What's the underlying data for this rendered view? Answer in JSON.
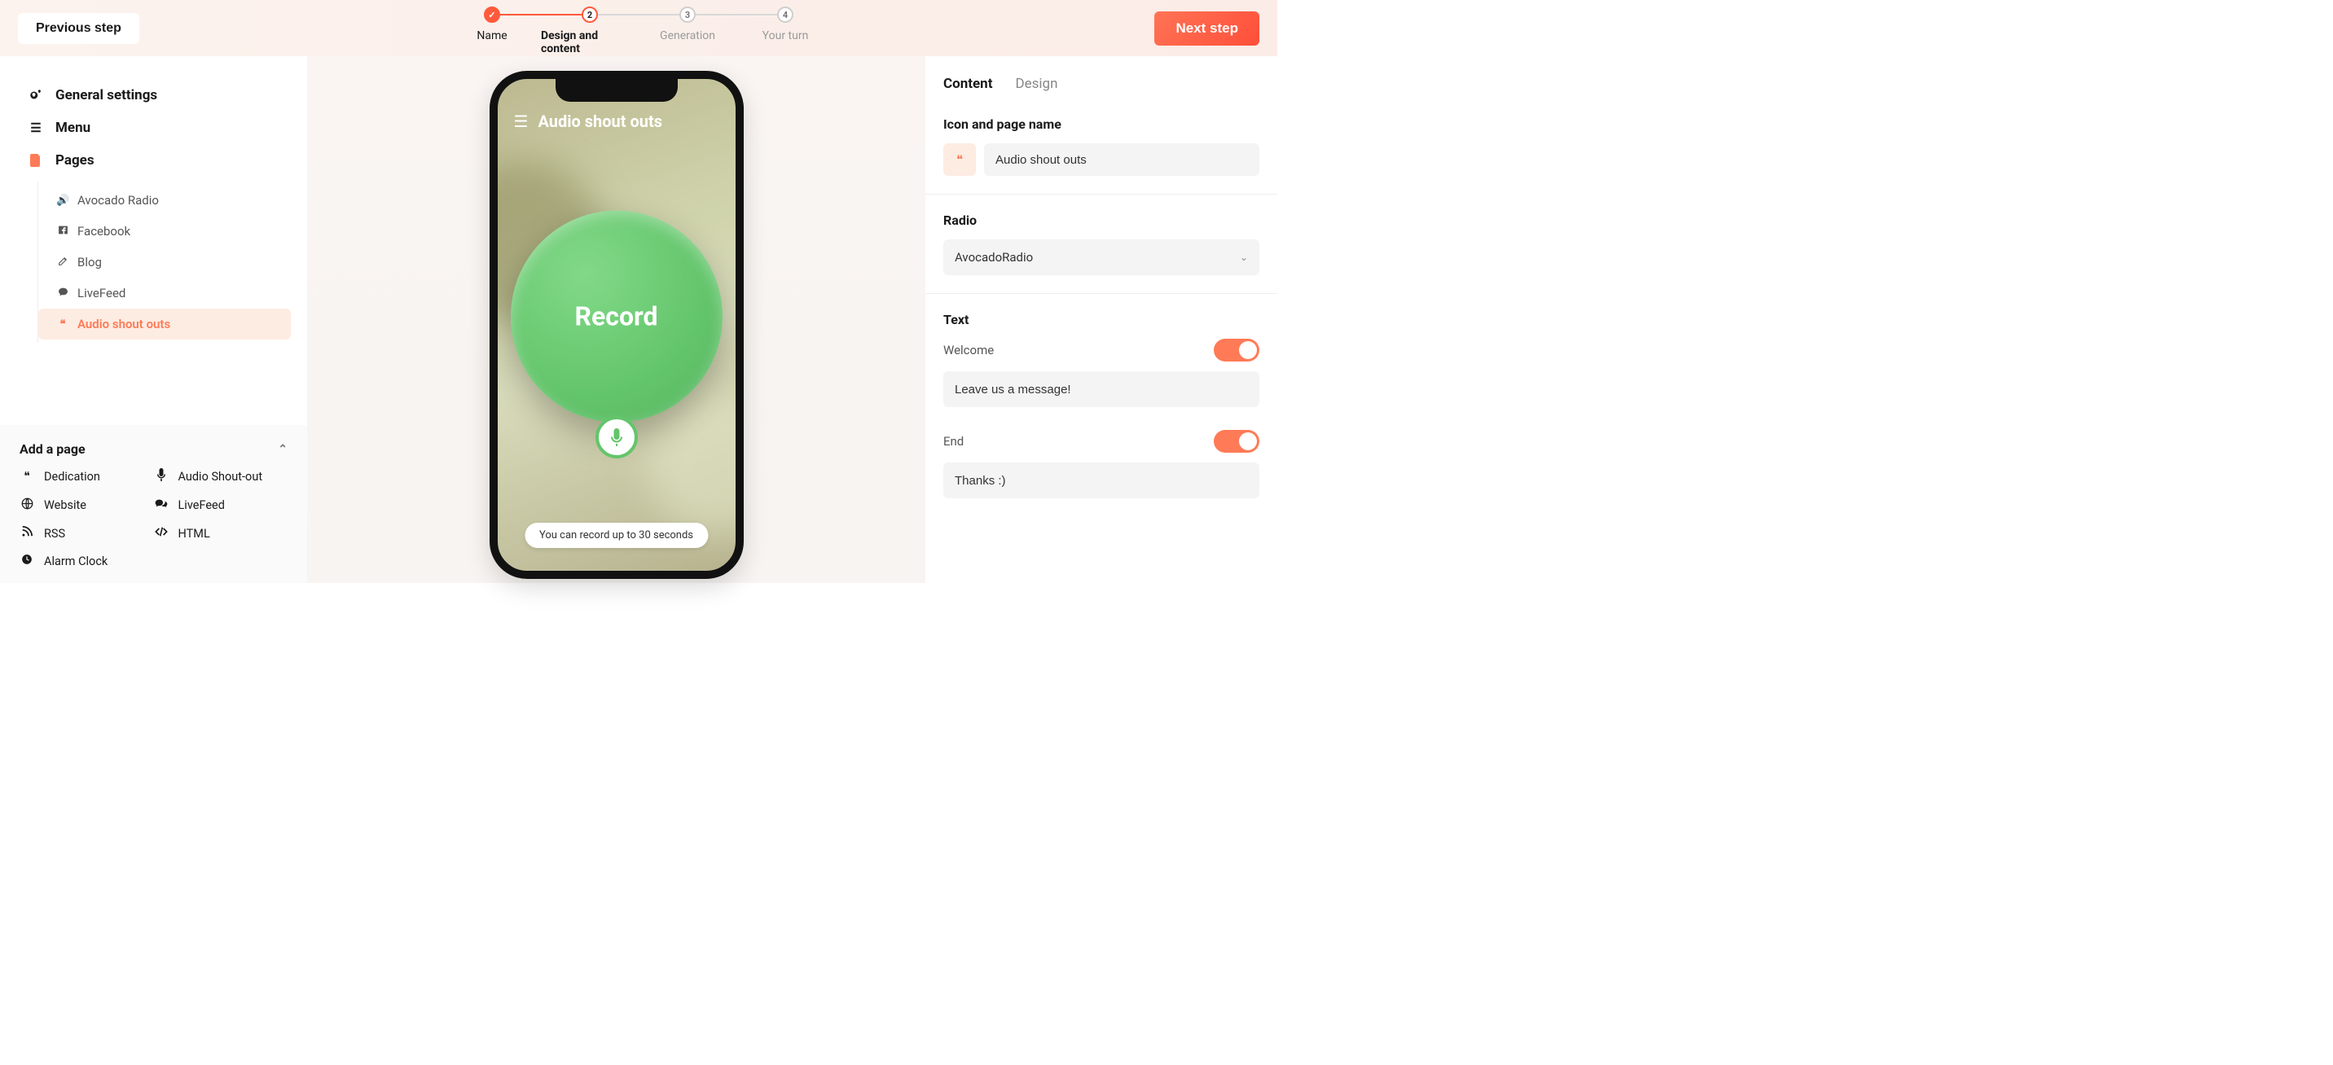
{
  "topbar": {
    "prev": "Previous step",
    "next": "Next step",
    "steps": [
      {
        "num": "✓",
        "label": "Name"
      },
      {
        "num": "2",
        "label": "Design and content"
      },
      {
        "num": "3",
        "label": "Generation"
      },
      {
        "num": "4",
        "label": "Your turn"
      }
    ]
  },
  "sidebar": {
    "general": "General settings",
    "menu": "Menu",
    "pages": "Pages",
    "pageItems": [
      {
        "icon": "volume",
        "label": "Avocado Radio"
      },
      {
        "icon": "facebook",
        "label": "Facebook"
      },
      {
        "icon": "edit",
        "label": "Blog"
      },
      {
        "icon": "comment",
        "label": "LiveFeed"
      },
      {
        "icon": "quote",
        "label": "Audio shout outs"
      }
    ],
    "addPage": {
      "title": "Add a page",
      "items": [
        {
          "icon": "quote",
          "label": "Dedication"
        },
        {
          "icon": "mic",
          "label": "Audio Shout-out"
        },
        {
          "icon": "globe",
          "label": "Website"
        },
        {
          "icon": "comments",
          "label": "LiveFeed"
        },
        {
          "icon": "rss",
          "label": "RSS"
        },
        {
          "icon": "code",
          "label": "HTML"
        },
        {
          "icon": "clock",
          "label": "Alarm Clock"
        }
      ]
    }
  },
  "preview": {
    "headerTitle": "Audio shout outs",
    "recordLabel": "Record",
    "tip": "You can record up to 30 seconds"
  },
  "panel": {
    "tabs": {
      "content": "Content",
      "design": "Design"
    },
    "iconName": {
      "label": "Icon and page name",
      "value": "Audio shout outs"
    },
    "radio": {
      "label": "Radio",
      "value": "AvocadoRadio"
    },
    "text": {
      "label": "Text",
      "welcome": {
        "label": "Welcome",
        "value": "Leave us a message!"
      },
      "end": {
        "label": "End",
        "value": "Thanks :)"
      }
    }
  }
}
